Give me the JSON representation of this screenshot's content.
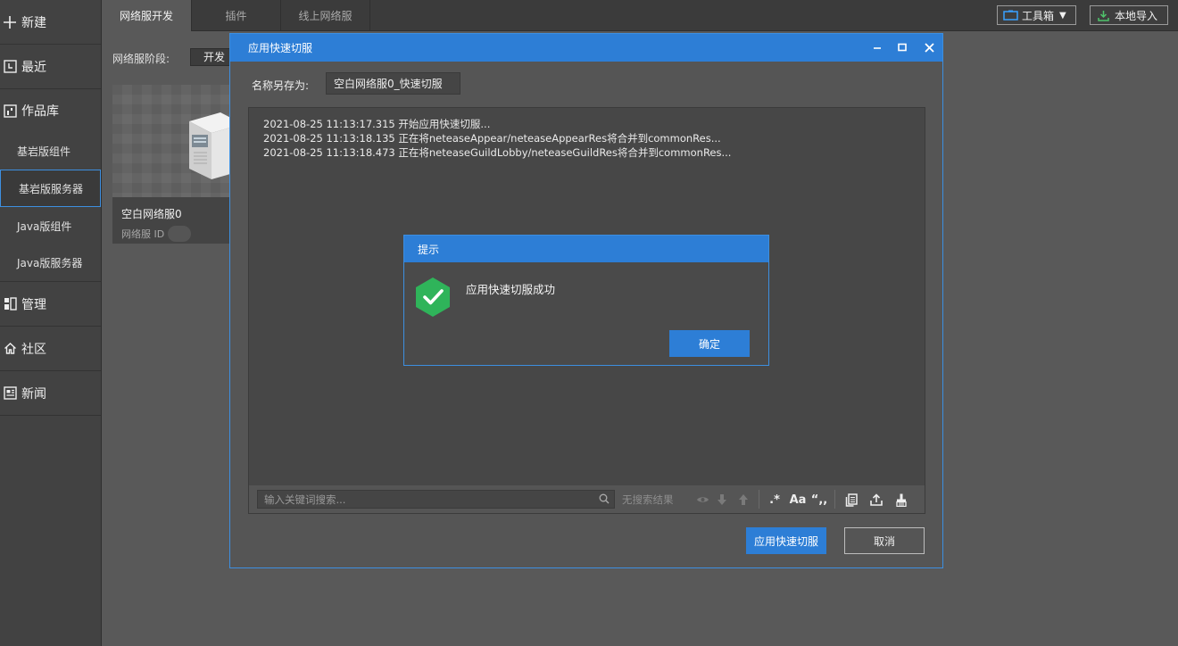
{
  "sidebar": {
    "items": [
      {
        "label": "新建",
        "icon": "plus-icon"
      },
      {
        "label": "最近",
        "icon": "clock-icon"
      }
    ],
    "library": {
      "label": "作品库",
      "icon": "library-icon",
      "subitems": [
        "基岩版组件",
        "基岩版服务器",
        "Java版组件",
        "Java版服务器"
      ],
      "active_index": 1
    },
    "bottom_items": [
      {
        "label": "管理",
        "icon": "manage-icon"
      },
      {
        "label": "社区",
        "icon": "home-icon"
      },
      {
        "label": "新闻",
        "icon": "news-icon"
      }
    ]
  },
  "topbar": {
    "tabs": [
      "网络服开发",
      "插件",
      "线上网络服"
    ],
    "active_tab": 0,
    "toolbox_label": "工具箱",
    "import_label": "本地导入"
  },
  "background": {
    "stage_label": "网络服阶段:",
    "stage_value": "开发阶段",
    "card_title": "空白网络服0",
    "card_sub": "网络服 ID"
  },
  "dialog": {
    "title": "应用快速切服",
    "save_label": "名称另存为:",
    "save_value": "空白网络服0_快速切服",
    "log_lines": [
      "2021-08-25 11:13:17.315 开始应用快速切服...",
      "2021-08-25 11:13:18.135 正在将neteaseAppear/neteaseAppearRes将合并到commonRes...",
      "2021-08-25 11:13:18.473 正在将neteaseGuildLobby/neteaseGuildRes将合并到commonRes..."
    ],
    "search_placeholder": "输入关键词搜索...",
    "no_result": "无搜索结果",
    "regex_label": ".*",
    "case_label": "Aa",
    "word_label": "“,,",
    "apply_button": "应用快速切服",
    "cancel_button": "取消"
  },
  "alert": {
    "title": "提示",
    "message": "应用快速切服成功",
    "ok_button": "确定"
  },
  "colors": {
    "accent": "#2d7ed6",
    "success": "#2fb45a",
    "background": "#595959",
    "sidebar": "#424242"
  }
}
